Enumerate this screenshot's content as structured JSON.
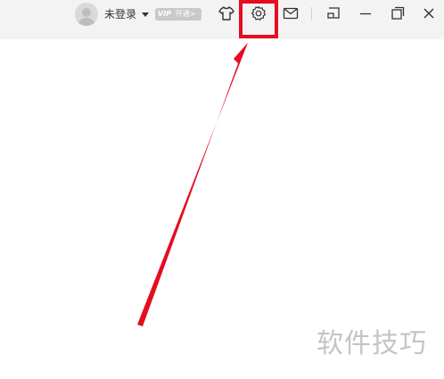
{
  "header": {
    "login_status": "未登录",
    "vip_badge": {
      "mark": "VIP",
      "label": "开通>"
    },
    "icons": {
      "avatar": "user-avatar-icon",
      "dropdown": "caret-down-icon",
      "skin": "tshirt-icon",
      "settings": "gear-icon",
      "mail": "mail-icon",
      "miniplayer": "picture-in-picture-icon",
      "minimize": "minimize-icon",
      "restore": "restore-icon",
      "close": "close-icon"
    },
    "highlight_color": "#e50d21"
  },
  "annotation": {
    "target": "settings-button",
    "color": "#e50d21"
  },
  "watermark": {
    "text": "软件技巧"
  }
}
